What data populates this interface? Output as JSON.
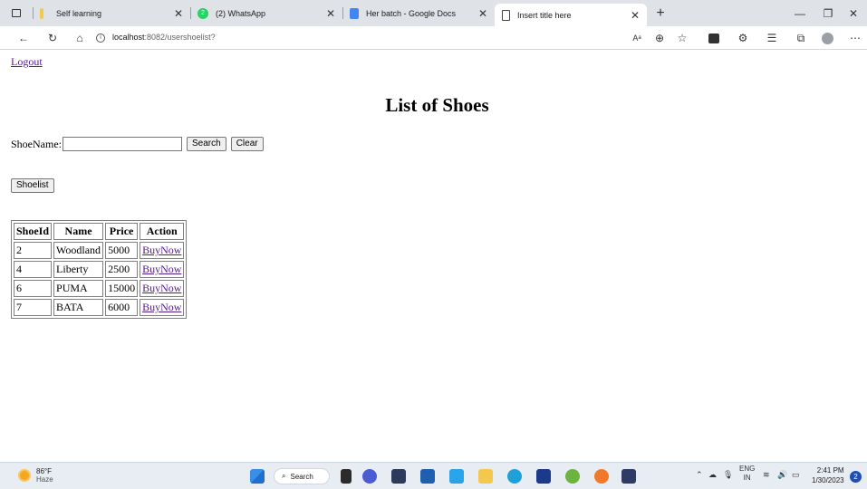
{
  "browser": {
    "tabs": [
      {
        "title": "Self learning",
        "favicon": "folder-icon"
      },
      {
        "title": "(2) WhatsApp",
        "favicon": "whatsapp-icon"
      },
      {
        "title": "Her batch - Google Docs",
        "favicon": "docs-icon"
      },
      {
        "title": "Insert title here",
        "favicon": "page-icon"
      }
    ],
    "url_host": "localhost",
    "url_path": ":8082/usershoelist?"
  },
  "page": {
    "logout_label": "Logout",
    "heading": "List of Shoes",
    "search_label": "ShoeName:",
    "search_value": "",
    "search_button": "Search",
    "clear_button": "Clear",
    "shoelist_button": "Shoelist",
    "table": {
      "headers": [
        "ShoeId",
        "Name",
        "Price",
        "Action"
      ],
      "rows": [
        {
          "id": "2",
          "name": "Woodland",
          "price": "5000",
          "action": "BuyNow"
        },
        {
          "id": "4",
          "name": "Liberty",
          "price": "2500",
          "action": "BuyNow"
        },
        {
          "id": "6",
          "name": "PUMA",
          "price": "15000",
          "action": "BuyNow"
        },
        {
          "id": "7",
          "name": "BATA",
          "price": "6000",
          "action": "BuyNow"
        }
      ]
    }
  },
  "taskbar": {
    "weather_temp": "86°F",
    "weather_desc": "Haze",
    "search_label": "Search",
    "language": "ENG",
    "region": "IN",
    "time": "2:41 PM",
    "date": "1/30/2023",
    "notification_count": "2"
  },
  "colors": {
    "link_visited": "#551a8b",
    "tabstrip_bg": "#dfe3e8",
    "taskbar_bg": "#e8edf3"
  }
}
